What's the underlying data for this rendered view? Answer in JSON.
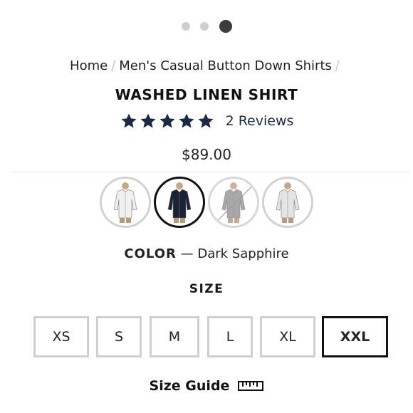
{
  "carousel": {
    "total": 3,
    "active_index": 2
  },
  "breadcrumb": {
    "items": [
      "Home",
      "Men's Casual Button Down Shirts"
    ],
    "separator": "/"
  },
  "product": {
    "title": "WASHED LINEN SHIRT",
    "rating": 5,
    "reviews_label": "2 Reviews",
    "price": "$89.00"
  },
  "swatches": [
    {
      "name": "white-shirt-swatch",
      "shirt_color": "#f0f0f0",
      "selected": false,
      "unavailable": false
    },
    {
      "name": "dark-sapphire-swatch",
      "shirt_color": "#1b2236",
      "selected": true,
      "unavailable": false
    },
    {
      "name": "grey-shirt-swatch",
      "shirt_color": "#9a9a9a",
      "selected": false,
      "unavailable": true
    },
    {
      "name": "light-grey-shirt-swatch",
      "shirt_color": "#e4e4e4",
      "selected": false,
      "unavailable": false
    }
  ],
  "color": {
    "label": "COLOR",
    "dash": "—",
    "value": "Dark Sapphire"
  },
  "size": {
    "label": "SIZE",
    "options": [
      "XS",
      "S",
      "M",
      "L",
      "XL",
      "XXL"
    ],
    "selected": "XXL"
  },
  "size_guide": {
    "label": "Size Guide",
    "icon": "ruler-icon"
  },
  "colors": {
    "star": "#1a2a4a",
    "selected_border": "#111111",
    "idle_border": "#d0d0d0"
  }
}
